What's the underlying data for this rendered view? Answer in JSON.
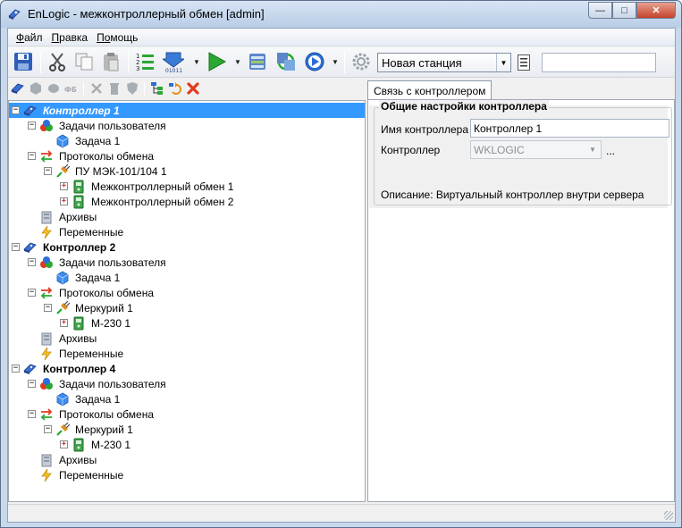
{
  "window": {
    "title": "EnLogic - межконтроллерный обмен [admin]",
    "buttons": {
      "minimize": "—",
      "maximize": "□",
      "close": "✕"
    }
  },
  "menu": [
    {
      "label": "Файл",
      "mnemonic": "Ф",
      "rest": "айл"
    },
    {
      "label": "Правка",
      "mnemonic": "П",
      "rest": "равка"
    },
    {
      "label": "Помощь",
      "mnemonic": "По",
      "rest": "мощь"
    }
  ],
  "toolbar": {
    "station": "Новая станция",
    "search_value": "",
    "icons": [
      "save-icon",
      "cut-icon",
      "copy-icon",
      "paste-icon",
      "numbered-list-icon",
      "download-binary-icon",
      "run-icon",
      "database-icon",
      "sync-icon",
      "play-circle-icon",
      "settings-gear-icon",
      "list-icon"
    ]
  },
  "tree": {
    "rows": [
      {
        "label": "Контроллер 1",
        "level": 0,
        "expander": "minus",
        "icon": "controller",
        "style": "selected"
      },
      {
        "label": "Задачи пользователя",
        "level": 1,
        "expander": "minus",
        "icon": "tasks"
      },
      {
        "label": "Задача 1",
        "level": 2,
        "expander": "",
        "icon": "cube"
      },
      {
        "label": "Протоколы обмена",
        "level": 1,
        "expander": "minus",
        "icon": "protocols"
      },
      {
        "label": "ПУ МЭК-101/104 1",
        "level": 2,
        "expander": "minus",
        "icon": "plug"
      },
      {
        "label": "Межконтроллерный обмен 1",
        "level": 3,
        "expander": "plus",
        "icon": "device"
      },
      {
        "label": "Межконтроллерный обмен 2",
        "level": 3,
        "expander": "plus",
        "icon": "device"
      },
      {
        "label": "Архивы",
        "level": 1,
        "expander": "",
        "icon": "archive"
      },
      {
        "label": "Переменные",
        "level": 1,
        "expander": "",
        "icon": "variables"
      },
      {
        "label": "Контроллер 2",
        "level": 0,
        "expander": "minus",
        "icon": "controller",
        "style": "bold"
      },
      {
        "label": "Задачи пользователя",
        "level": 1,
        "expander": "minus",
        "icon": "tasks"
      },
      {
        "label": "Задача 1",
        "level": 2,
        "expander": "",
        "icon": "cube"
      },
      {
        "label": "Протоколы обмена",
        "level": 1,
        "expander": "minus",
        "icon": "protocols"
      },
      {
        "label": "Меркурий 1",
        "level": 2,
        "expander": "minus",
        "icon": "plug"
      },
      {
        "label": "М-230 1",
        "level": 3,
        "expander": "plus",
        "icon": "device"
      },
      {
        "label": "Архивы",
        "level": 1,
        "expander": "",
        "icon": "archive"
      },
      {
        "label": "Переменные",
        "level": 1,
        "expander": "",
        "icon": "variables"
      },
      {
        "label": "Контроллер 4",
        "level": 0,
        "expander": "minus",
        "icon": "controller",
        "style": "bold"
      },
      {
        "label": "Задачи пользователя",
        "level": 1,
        "expander": "minus",
        "icon": "tasks"
      },
      {
        "label": "Задача 1",
        "level": 2,
        "expander": "",
        "icon": "cube"
      },
      {
        "label": "Протоколы обмена",
        "level": 1,
        "expander": "minus",
        "icon": "protocols"
      },
      {
        "label": "Меркурий 1",
        "level": 2,
        "expander": "minus",
        "icon": "plug"
      },
      {
        "label": "М-230 1",
        "level": 3,
        "expander": "plus",
        "icon": "device"
      },
      {
        "label": "Архивы",
        "level": 1,
        "expander": "",
        "icon": "archive"
      },
      {
        "label": "Переменные",
        "level": 1,
        "expander": "",
        "icon": "variables"
      }
    ]
  },
  "props": {
    "tab": "Связь с контроллером",
    "group_title": "Общие настройки контроллера",
    "name_label": "Имя контроллера",
    "name_value": "Контроллер 1",
    "controller_label": "Контроллер",
    "controller_value": "WKLOGIC",
    "ellipsis": "...",
    "description": "Описание: Виртуальный контроллер внутри сервера"
  },
  "colors": {
    "selection": "#3399ff",
    "accent_red": "#e03a1e",
    "accent_green": "#2aa832",
    "accent_blue": "#2a6fd6"
  }
}
